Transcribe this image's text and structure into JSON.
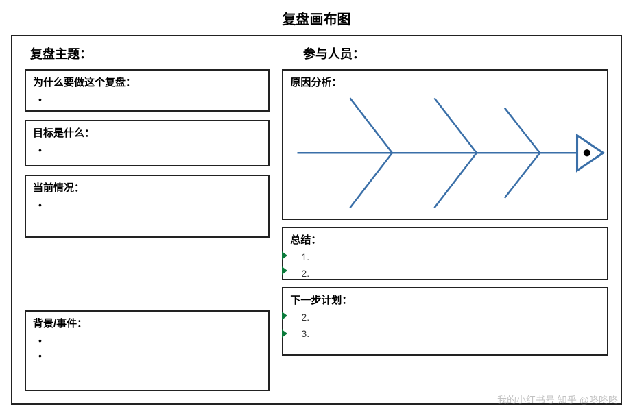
{
  "title": "复盘画布图",
  "headers": {
    "topic": "复盘主题：",
    "participants": "参与人员："
  },
  "left": {
    "why": {
      "title": "为什么要做这个复盘：",
      "items": [
        "•"
      ]
    },
    "goal": {
      "title": "目标是什么：",
      "items": [
        "•"
      ]
    },
    "current": {
      "title": "当前情况：",
      "items": [
        "•"
      ]
    },
    "background": {
      "title": "背景/事件：",
      "items": [
        "•",
        "•"
      ]
    }
  },
  "right": {
    "cause": {
      "title": "原因分析："
    },
    "summary": {
      "title": "总结：",
      "items": [
        "1.",
        "2."
      ]
    },
    "next": {
      "title": "下一步计划：",
      "items": [
        "2.",
        "3."
      ]
    }
  },
  "watermark": "我的小红书号  知乎 @咚咚咚",
  "colors": {
    "border": "#222222",
    "fishbone": "#3a6fa8",
    "marker": "#0a7a3a"
  }
}
